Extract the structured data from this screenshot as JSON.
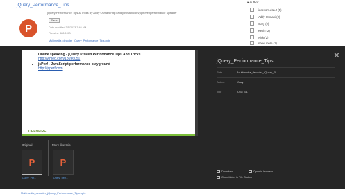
{
  "background": {
    "result_title": "jQuery_Performance_Tips",
    "file_letter": "P",
    "snippet": "jQuery Performance Tips & Tricks By Addy Osmani http://addyosmani.com/jqprovenperformance Speaker",
    "pill_label": "Save",
    "meta_lines": [
      "Date modified 3/1/2013 7:46 AM",
      "File size: 388.6 KB"
    ],
    "path_link": "Multimedia_decoder_jQuery_Performance_Tips.pptx",
    "facet_header": "Author",
    "facets": [
      "ieeecom.dsn.2 (5)",
      "Addy Osmani (2)",
      "Gary (2)",
      "Kevin (2)",
      "Nick (2)",
      "show more (1)"
    ],
    "bottom_link": "Multimedia_decoder_jQuery_Performance_Tips.pptx"
  },
  "preview": {
    "bullets": [
      {
        "text": "Online speaking - jQuery Proven Performance Tips And Tricks",
        "url": "http://vimeo.com/18696051"
      },
      {
        "text": "jsPerf - JavaScript performance playground",
        "url": "http://jsperf.com"
      }
    ],
    "doc_logo": "OPENFIRE",
    "original_label": "Original",
    "more_label": "More like this",
    "thumb_letter": "P",
    "original_caption": "jQuery_Per...",
    "more_caption": "jQuery_perf..."
  },
  "info": {
    "title": "jQuery_Performance_Tips",
    "rows": [
      {
        "key": "Path",
        "value": "Multimedia_decoder_jQuery_P..."
      },
      {
        "key": "Author",
        "value": "Gary"
      },
      {
        "key": "Title",
        "value": "CSE 3.1"
      }
    ]
  },
  "actions": {
    "download": "Download",
    "open_browser": "Open in browser",
    "open_folder": "Open folder in File Station"
  }
}
